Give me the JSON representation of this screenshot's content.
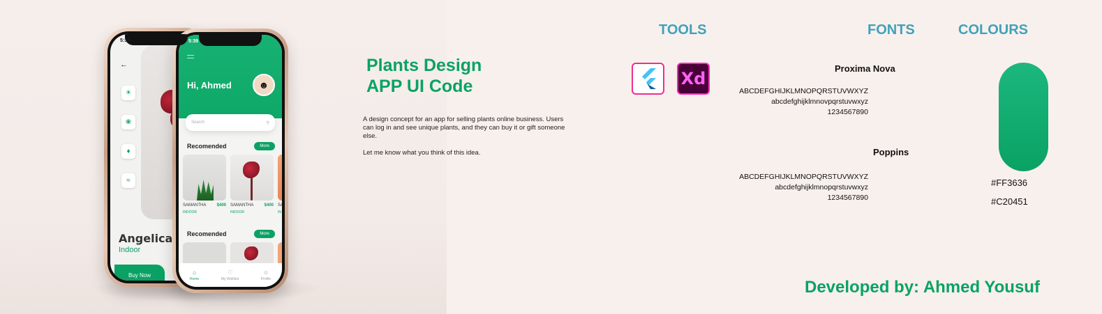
{
  "mockup": {
    "back_phone": {
      "time": "5:39",
      "title": "Angelica",
      "subtitle": "Indoor",
      "buy_label": "Buy Now"
    },
    "front_phone": {
      "time": "5:39",
      "greeting": "Hi, Ahmed",
      "search_placeholder": "Search",
      "sections": [
        {
          "title": "Recomended",
          "more_label": "More",
          "cards": [
            {
              "name": "SAMANTHA",
              "price": "$400",
              "category": "INDOOR"
            },
            {
              "name": "SAMANTHA",
              "price": "$400",
              "category": "INDOOR"
            },
            {
              "name": "SA",
              "price": "",
              "category": "IN"
            }
          ]
        },
        {
          "title": "Recomended",
          "more_label": "More"
        }
      ],
      "nav": [
        {
          "label": "Home",
          "icon": "home-icon"
        },
        {
          "label": "My Wishlist",
          "icon": "heart-icon"
        },
        {
          "label": "Profile",
          "icon": "profile-icon"
        }
      ]
    }
  },
  "info": {
    "headline_line1": "Plants Design",
    "headline_line2": "APP UI Code",
    "description": "A design concept for an app for selling plants online business. Users can log in and see unique plants, and they can buy it or gift someone else.",
    "feedback": "Let me know what you think of this idea."
  },
  "tools": {
    "heading": "TOOLS",
    "items": [
      {
        "name": "Flutter",
        "icon": "flutter-icon"
      },
      {
        "name": "Adobe XD",
        "icon": "adobe-xd-icon",
        "glyph": "Xd"
      }
    ]
  },
  "fonts": {
    "heading": "FONTS",
    "items": [
      {
        "name": "Proxima Nova",
        "upper": "ABCDEFGHIJKLMNOPQRSTUVWXYZ",
        "lower": "abcdefghijklmnovpqrstuvwxyz",
        "digits": "1234567890"
      },
      {
        "name": "Poppins",
        "upper": "ABCDEFGHIJKLMNOPQRSTUVWXYZ",
        "lower": "abcdefghijklmnopqrstuvwxyz",
        "digits": "1234567890"
      }
    ]
  },
  "colours": {
    "heading": "COLOURS",
    "swatch_color": "#0aa264",
    "values": [
      "#FF3636",
      "#C20451"
    ]
  },
  "credit": "Developed by: Ahmed Yousuf"
}
